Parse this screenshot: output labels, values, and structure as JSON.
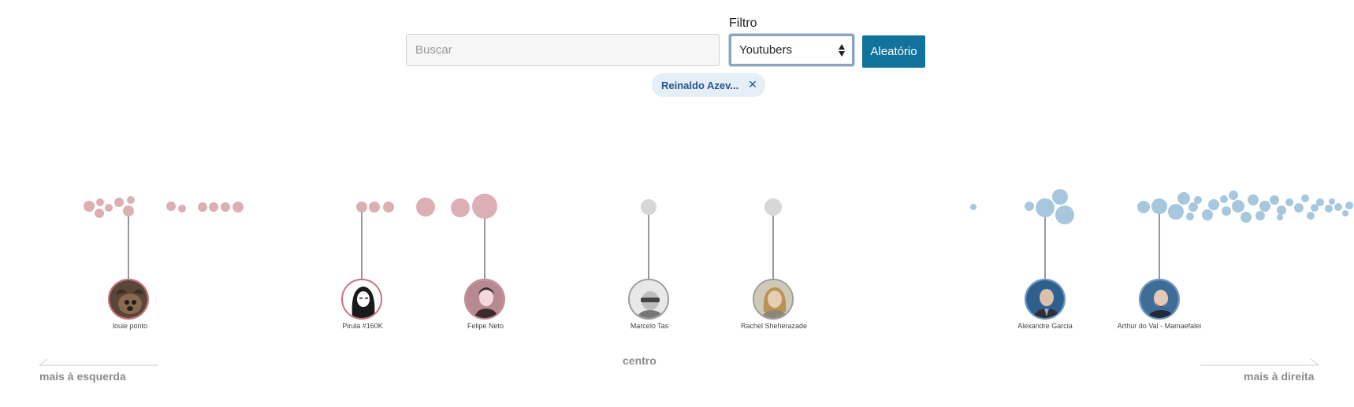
{
  "controls": {
    "search_placeholder": "Buscar",
    "filter_label": "Filtro",
    "filter_value": "Youtubers",
    "random_button": "Aleatório",
    "active_tag": "Reinaldo Azev..."
  },
  "scale": {
    "left_label": "mais à esquerda",
    "center_label": "centro",
    "right_label": "mais à direita"
  },
  "colors": {
    "left": "#dcafb5",
    "neutral": "#d7d7d7",
    "right": "#a7c7de",
    "accent_button": "#11739c",
    "chip_bg": "#e6eff8"
  },
  "people": [
    {
      "name": "louie ponto",
      "side": "left",
      "avatar_icon": "dog-photo-icon"
    },
    {
      "name": "Pirula #160K",
      "side": "left",
      "avatar_icon": "sketch-face-icon"
    },
    {
      "name": "Felipe Neto",
      "side": "left",
      "avatar_icon": "person-photo-icon"
    },
    {
      "name": "Marcelo Tas",
      "side": "neutral",
      "avatar_icon": "person-photo-icon"
    },
    {
      "name": "Rachel Sheherazade",
      "side": "neutral",
      "avatar_icon": "person-photo-icon"
    },
    {
      "name": "Alexandre Garcia",
      "side": "right",
      "avatar_icon": "person-photo-icon"
    },
    {
      "name": "Arthur do Val - Mamaefalei",
      "side": "right",
      "avatar_icon": "person-photo-icon"
    }
  ]
}
